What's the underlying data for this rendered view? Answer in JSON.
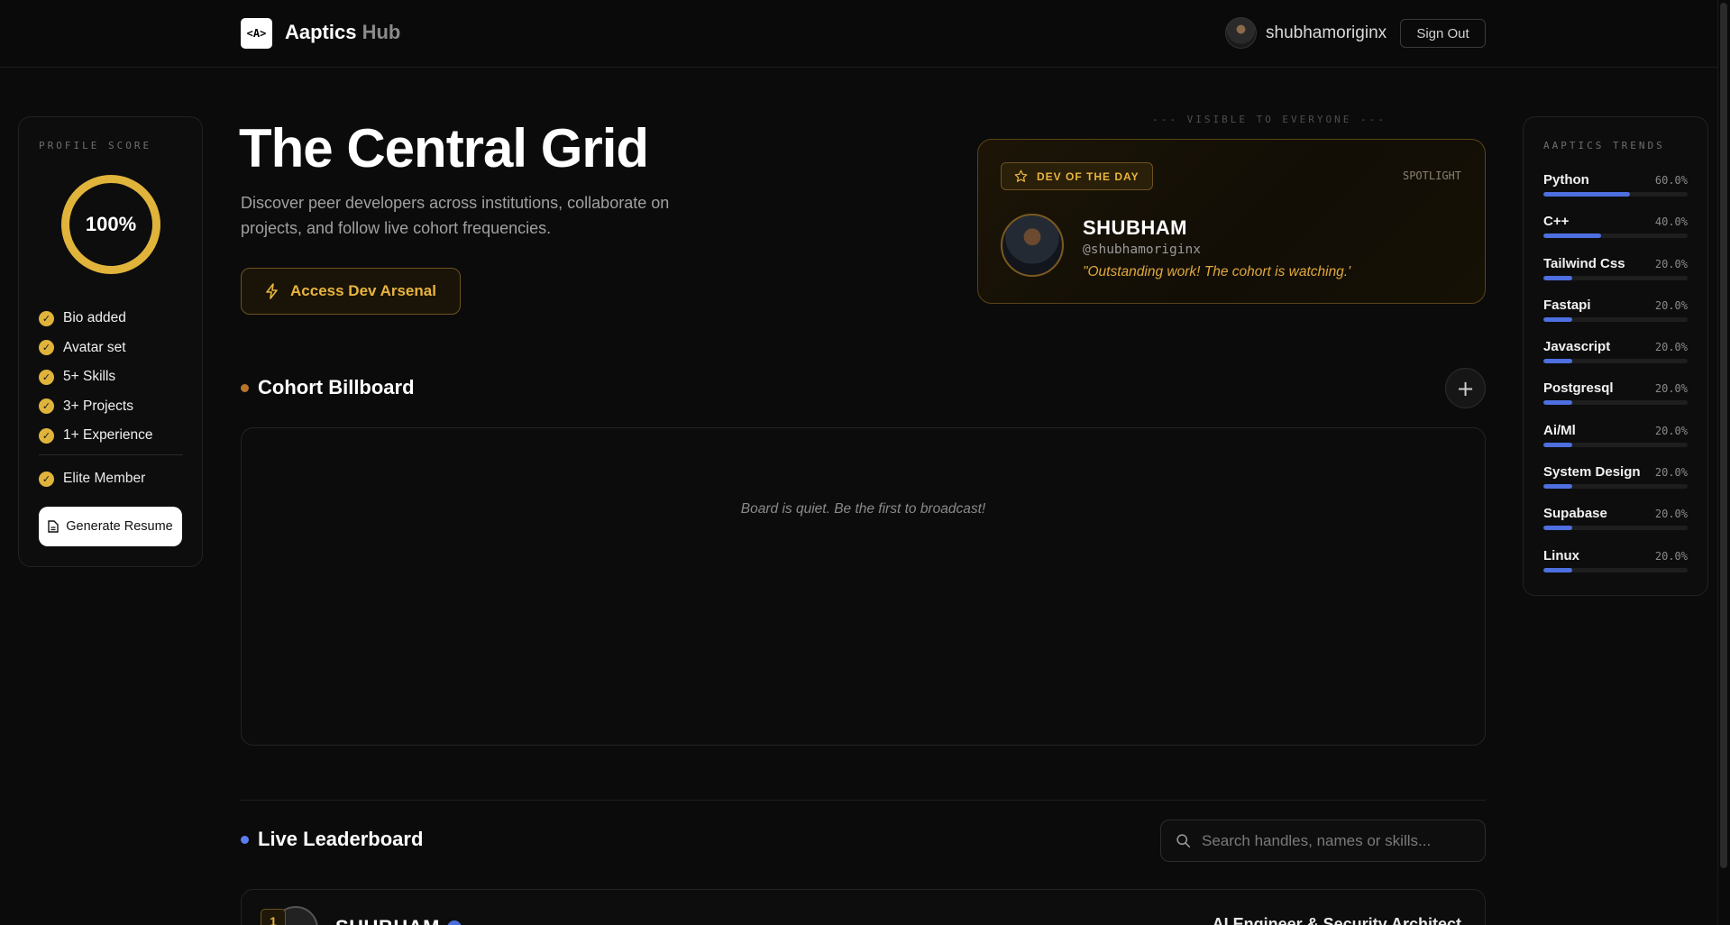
{
  "nav": {
    "logo_text": "<A>",
    "brand_main": "Aaptics",
    "brand_sub": " Hub",
    "username": "shubhamoriginx",
    "signout_label": "Sign Out"
  },
  "profile": {
    "label": "PROFILE SCORE",
    "score": "100%",
    "checklist": [
      {
        "label": "Bio added"
      },
      {
        "label": "Avatar set"
      },
      {
        "label": "5+ Skills"
      },
      {
        "label": "3+ Projects"
      },
      {
        "label": "1+ Experience"
      }
    ],
    "elite_label": "Elite Member",
    "resume_label": "Generate Resume"
  },
  "hero": {
    "title": "The Central Grid",
    "subtitle": "Discover peer developers across institutions, collaborate on projects, and follow live cohort frequencies.",
    "cta_label": "Access Dev Arsenal"
  },
  "spotlight": {
    "visibility_label": "--- VISIBLE TO EVERYONE ---",
    "badge_label": "DEV OF THE DAY",
    "tag": "SPOTLIGHT",
    "name": "SHUBHAM",
    "handle": "@shubhamoriginx",
    "quote": "\"Outstanding work! The cohort is watching.'"
  },
  "billboard": {
    "title": "Cohort Billboard",
    "add_symbol": "+",
    "empty_message": "Board is quiet. Be the first to broadcast!"
  },
  "leaderboard": {
    "title": "Live Leaderboard",
    "search_placeholder": "Search handles, names or skills...",
    "rows": [
      {
        "rank": "1",
        "name": "SHUBHAM",
        "role": "AI Engineer & Security Architect"
      }
    ]
  },
  "trends": {
    "label": "AAPTICS TRENDS",
    "items": [
      {
        "name": "Python",
        "pct": "60.0%",
        "value": 60
      },
      {
        "name": "C++",
        "pct": "40.0%",
        "value": 40
      },
      {
        "name": "Tailwind Css",
        "pct": "20.0%",
        "value": 20
      },
      {
        "name": "Fastapi",
        "pct": "20.0%",
        "value": 20
      },
      {
        "name": "Javascript",
        "pct": "20.0%",
        "value": 20
      },
      {
        "name": "Postgresql",
        "pct": "20.0%",
        "value": 20
      },
      {
        "name": "Ai/Ml",
        "pct": "20.0%",
        "value": 20
      },
      {
        "name": "System Design",
        "pct": "20.0%",
        "value": 20
      },
      {
        "name": "Supabase",
        "pct": "20.0%",
        "value": 20
      },
      {
        "name": "Linux",
        "pct": "20.0%",
        "value": 20
      }
    ]
  },
  "colors": {
    "accent_gold": "#e0b43b",
    "accent_blue": "#4d6fe0",
    "billboard_dot": "#b8752a",
    "leaderboard_dot": "#5b7df0"
  }
}
